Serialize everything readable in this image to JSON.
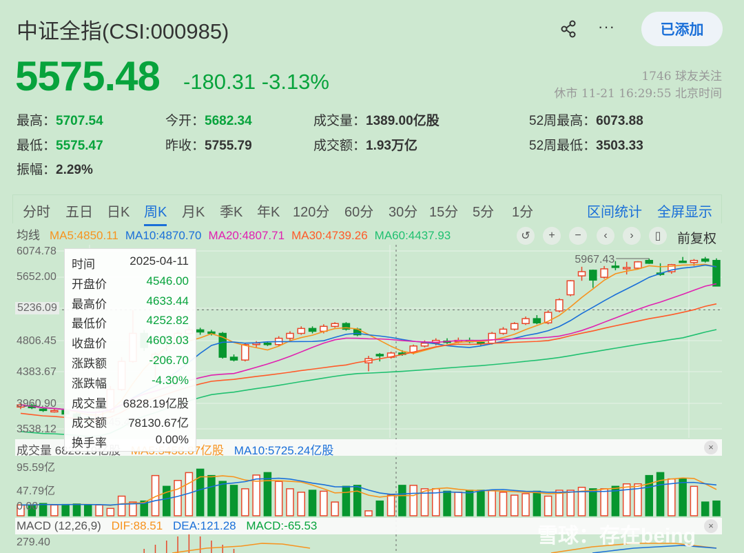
{
  "header": {
    "title": "中证全指(CSI:000985)",
    "share_icon": "share-icon",
    "more_label": "···",
    "added_label": "已添加",
    "price": "5575.48",
    "change": "-180.31",
    "change_pct": "-3.13%",
    "followers": "1746 球友关注",
    "status": "休市 11-21 16:29:55 北京时间"
  },
  "stats": [
    {
      "label": "最高：",
      "value": "5707.54",
      "color": "green"
    },
    {
      "label": "今开：",
      "value": "5682.34",
      "color": "green"
    },
    {
      "label": "成交量：",
      "value": "1389.00亿股",
      "color": "dark"
    },
    {
      "label": "52周最高：",
      "value": "6073.88",
      "color": "dark"
    },
    {
      "label": "最低：",
      "value": "5575.47",
      "color": "green"
    },
    {
      "label": "昨收：",
      "value": "5755.79",
      "color": "dark"
    },
    {
      "label": "成交额：",
      "value": "1.93万亿",
      "color": "dark"
    },
    {
      "label": "52周最低：",
      "value": "3503.33",
      "color": "dark"
    },
    {
      "label": "振幅：",
      "value": "2.29%",
      "color": "dark"
    }
  ],
  "tabs": [
    "分时",
    "五日",
    "日K",
    "周K",
    "月K",
    "季K",
    "年K",
    "120分",
    "60分",
    "30分",
    "15分",
    "5分",
    "1分"
  ],
  "active_tab": "周K",
  "links": [
    "区间统计",
    "全屏显示"
  ],
  "ma": {
    "label": "均线",
    "items": [
      {
        "text": "MA5:4850.11",
        "color": "#f7931e"
      },
      {
        "text": "MA10:4870.70",
        "color": "#1a6fd8"
      },
      {
        "text": "MA20:4807.71",
        "color": "#e020b0"
      },
      {
        "text": "MA30:4739.26",
        "color": "#ff5a28"
      },
      {
        "text": "MA60:4437.93",
        "color": "#20c070"
      }
    ]
  },
  "controls": [
    "↺",
    "+",
    "−",
    "‹",
    "›",
    "▯"
  ],
  "fuquan": "前复权",
  "y_axis": [
    "6074.78",
    "5652.00",
    "5236.09",
    "4806.45",
    "4383.67",
    "3960.90",
    "3538.12"
  ],
  "annotations": {
    "high": "5967.43",
    "low": "3645.47"
  },
  "tooltip": [
    {
      "label": "时间",
      "value": "2025-04-11",
      "color": "dark"
    },
    {
      "label": "开盘价",
      "value": "4546.00",
      "color": "green"
    },
    {
      "label": "最高价",
      "value": "4633.44",
      "color": "green"
    },
    {
      "label": "最低价",
      "value": "4252.82",
      "color": "green"
    },
    {
      "label": "收盘价",
      "value": "4603.03",
      "color": "green"
    },
    {
      "label": "涨跌额",
      "value": "-206.70",
      "color": "green"
    },
    {
      "label": "涨跌幅",
      "value": "-4.30%",
      "color": "green"
    },
    {
      "label": "成交量",
      "value": "6828.19亿股",
      "color": "dark"
    },
    {
      "label": "成交额",
      "value": "78130.67亿",
      "color": "dark"
    },
    {
      "label": "换手率",
      "value": "0.00%",
      "color": "dark"
    }
  ],
  "volume": {
    "label": "成交量 6828.19亿股",
    "ma5": "MA5:5458.87亿股",
    "ma10": "MA10:5725.24亿股",
    "y_axis": [
      "95.59亿",
      "47.79亿",
      "0.00"
    ]
  },
  "macd": {
    "label": "MACD (12,26,9)",
    "dif": "DIF:88.51",
    "dea": "DEA:121.28",
    "macd": "MACD:-65.53",
    "y_top": "279.40"
  },
  "watermark": "雪球：存在being",
  "colors": {
    "up": "#e8472a",
    "down": "#07962f",
    "accent": "#1a6fd8"
  },
  "candles_ohlc": [
    [
      3850,
      3880,
      3900,
      3820
    ],
    [
      3870,
      3840,
      3900,
      3820
    ],
    [
      3820,
      3800,
      3840,
      3780
    ],
    [
      3790,
      3800,
      3830,
      3770
    ],
    [
      3800,
      3750,
      3830,
      3700
    ],
    [
      3750,
      3700,
      3780,
      3660
    ],
    [
      3700,
      3646,
      3720,
      3645
    ],
    [
      3640,
      3780,
      3800,
      3645
    ],
    [
      3780,
      4100,
      4150,
      3770
    ],
    [
      4100,
      4500,
      4560,
      4080
    ],
    [
      4500,
      4900,
      5230,
      4480
    ],
    [
      4900,
      4700,
      4950,
      4650
    ],
    [
      4546,
      4603,
      4633,
      4253
    ],
    [
      4850,
      4806,
      4880,
      4650
    ],
    [
      4806,
      4900,
      4920,
      4780
    ],
    [
      4900,
      4950,
      5000,
      4880
    ],
    [
      4950,
      4920,
      4980,
      4880
    ],
    [
      4920,
      4900,
      4950,
      4870
    ],
    [
      4900,
      4560,
      4920,
      4540
    ],
    [
      4560,
      4520,
      4600,
      4500
    ],
    [
      4520,
      4740,
      4760,
      4500
    ],
    [
      4740,
      4760,
      4790,
      4700
    ],
    [
      4760,
      4740,
      4780,
      4720
    ],
    [
      4740,
      4830,
      4860,
      4720
    ],
    [
      4830,
      4900,
      4930,
      4800
    ],
    [
      4900,
      4970,
      5000,
      4880
    ],
    [
      4970,
      4930,
      5000,
      4900
    ],
    [
      4930,
      5000,
      5030,
      4900
    ],
    [
      5000,
      5040,
      5060,
      4980
    ],
    [
      5040,
      4960,
      5060,
      4940
    ],
    [
      4960,
      4880,
      4980,
      4860
    ],
    [
      4480,
      4540,
      4580,
      4360
    ],
    [
      4600,
      4580,
      4620,
      4500
    ],
    [
      4560,
      4620,
      4640,
      4540
    ],
    [
      4620,
      4610,
      4660,
      4580
    ],
    [
      4630,
      4720,
      4740,
      4600
    ],
    [
      4720,
      4760,
      4800,
      4700
    ],
    [
      4760,
      4800,
      4830,
      4730
    ],
    [
      4790,
      4780,
      4830,
      4750
    ],
    [
      4780,
      4800,
      4840,
      4760
    ],
    [
      4800,
      4780,
      4840,
      4760
    ],
    [
      4770,
      4760,
      4800,
      4730
    ],
    [
      4760,
      4900,
      4920,
      4740
    ],
    [
      4900,
      4960,
      4990,
      4880
    ],
    [
      4960,
      5040,
      5060,
      4940
    ],
    [
      5040,
      5110,
      5140,
      5020
    ],
    [
      5110,
      5050,
      5160,
      5030
    ],
    [
      5050,
      5200,
      5230,
      5030
    ],
    [
      5220,
      5380,
      5400,
      5200
    ],
    [
      5450,
      5650,
      5660,
      5430
    ],
    [
      5720,
      5780,
      5850,
      5650
    ],
    [
      5800,
      5660,
      5810,
      5550
    ],
    [
      5700,
      5820,
      5860,
      5680
    ],
    [
      5860,
      5840,
      5930,
      5800
    ],
    [
      5830,
      5840,
      5920,
      5740
    ],
    [
      5830,
      5920,
      5930,
      5820
    ],
    [
      5940,
      5900,
      5967,
      5890
    ],
    [
      5760,
      5750,
      5900,
      5720
    ],
    [
      5780,
      5880,
      5890,
      5750
    ],
    [
      5930,
      5920,
      5990,
      5910
    ],
    [
      5910,
      5940,
      5960,
      5860
    ],
    [
      5960,
      5930,
      5990,
      5910
    ],
    [
      5940,
      5575,
      5970,
      5575
    ]
  ],
  "volumes": [
    22,
    22,
    25,
    22,
    23,
    24,
    22,
    22,
    15,
    40,
    28,
    30,
    82,
    60,
    72,
    88,
    95,
    82,
    70,
    62,
    55,
    83,
    88,
    70,
    55,
    48,
    52,
    50,
    28,
    60,
    62,
    10,
    30,
    42,
    62,
    62,
    55,
    55,
    50,
    48,
    52,
    52,
    52,
    48,
    42,
    45,
    50,
    40,
    52,
    52,
    58,
    55,
    55,
    60,
    65,
    65,
    82,
    88,
    75,
    75,
    60,
    28,
    30,
    62,
    60,
    60,
    58,
    60
  ]
}
